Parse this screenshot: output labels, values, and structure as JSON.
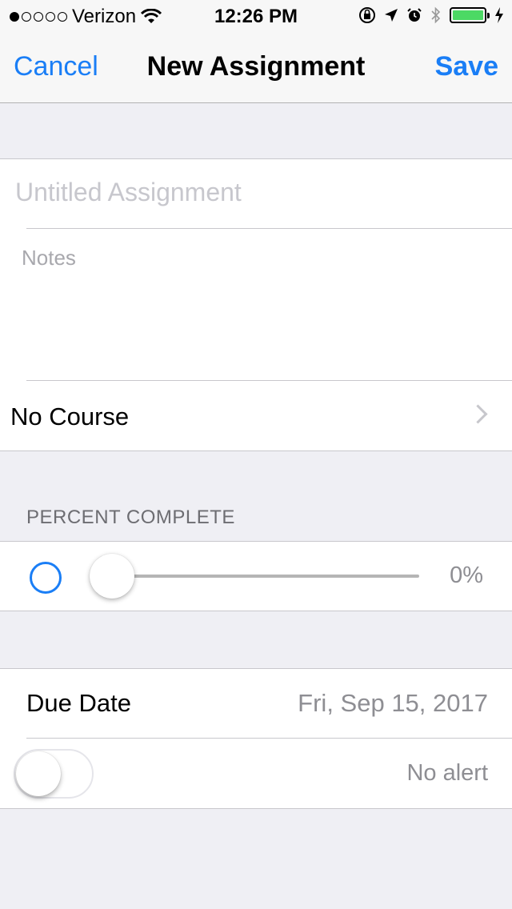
{
  "status_bar": {
    "carrier": "Verizon",
    "time": "12:26 PM",
    "signal_bars_filled": 1,
    "signal_bars_total": 5,
    "battery_level": 1.0
  },
  "nav": {
    "cancel": "Cancel",
    "title": "New Assignment",
    "save": "Save"
  },
  "form": {
    "title_placeholder": "Untitled Assignment",
    "title_value": "",
    "notes_placeholder": "Notes",
    "notes_value": "",
    "course": "No Course"
  },
  "progress": {
    "section_header": "PERCENT COMPLETE",
    "value_label": "0%",
    "value": 0
  },
  "due": {
    "label": "Due Date",
    "value": "Fri, Sep 15, 2017",
    "alert_label": "No alert",
    "alert_enabled": false
  },
  "colors": {
    "accent": "#1a7ef6",
    "background": "#efeff4",
    "battery": "#4cd964"
  }
}
